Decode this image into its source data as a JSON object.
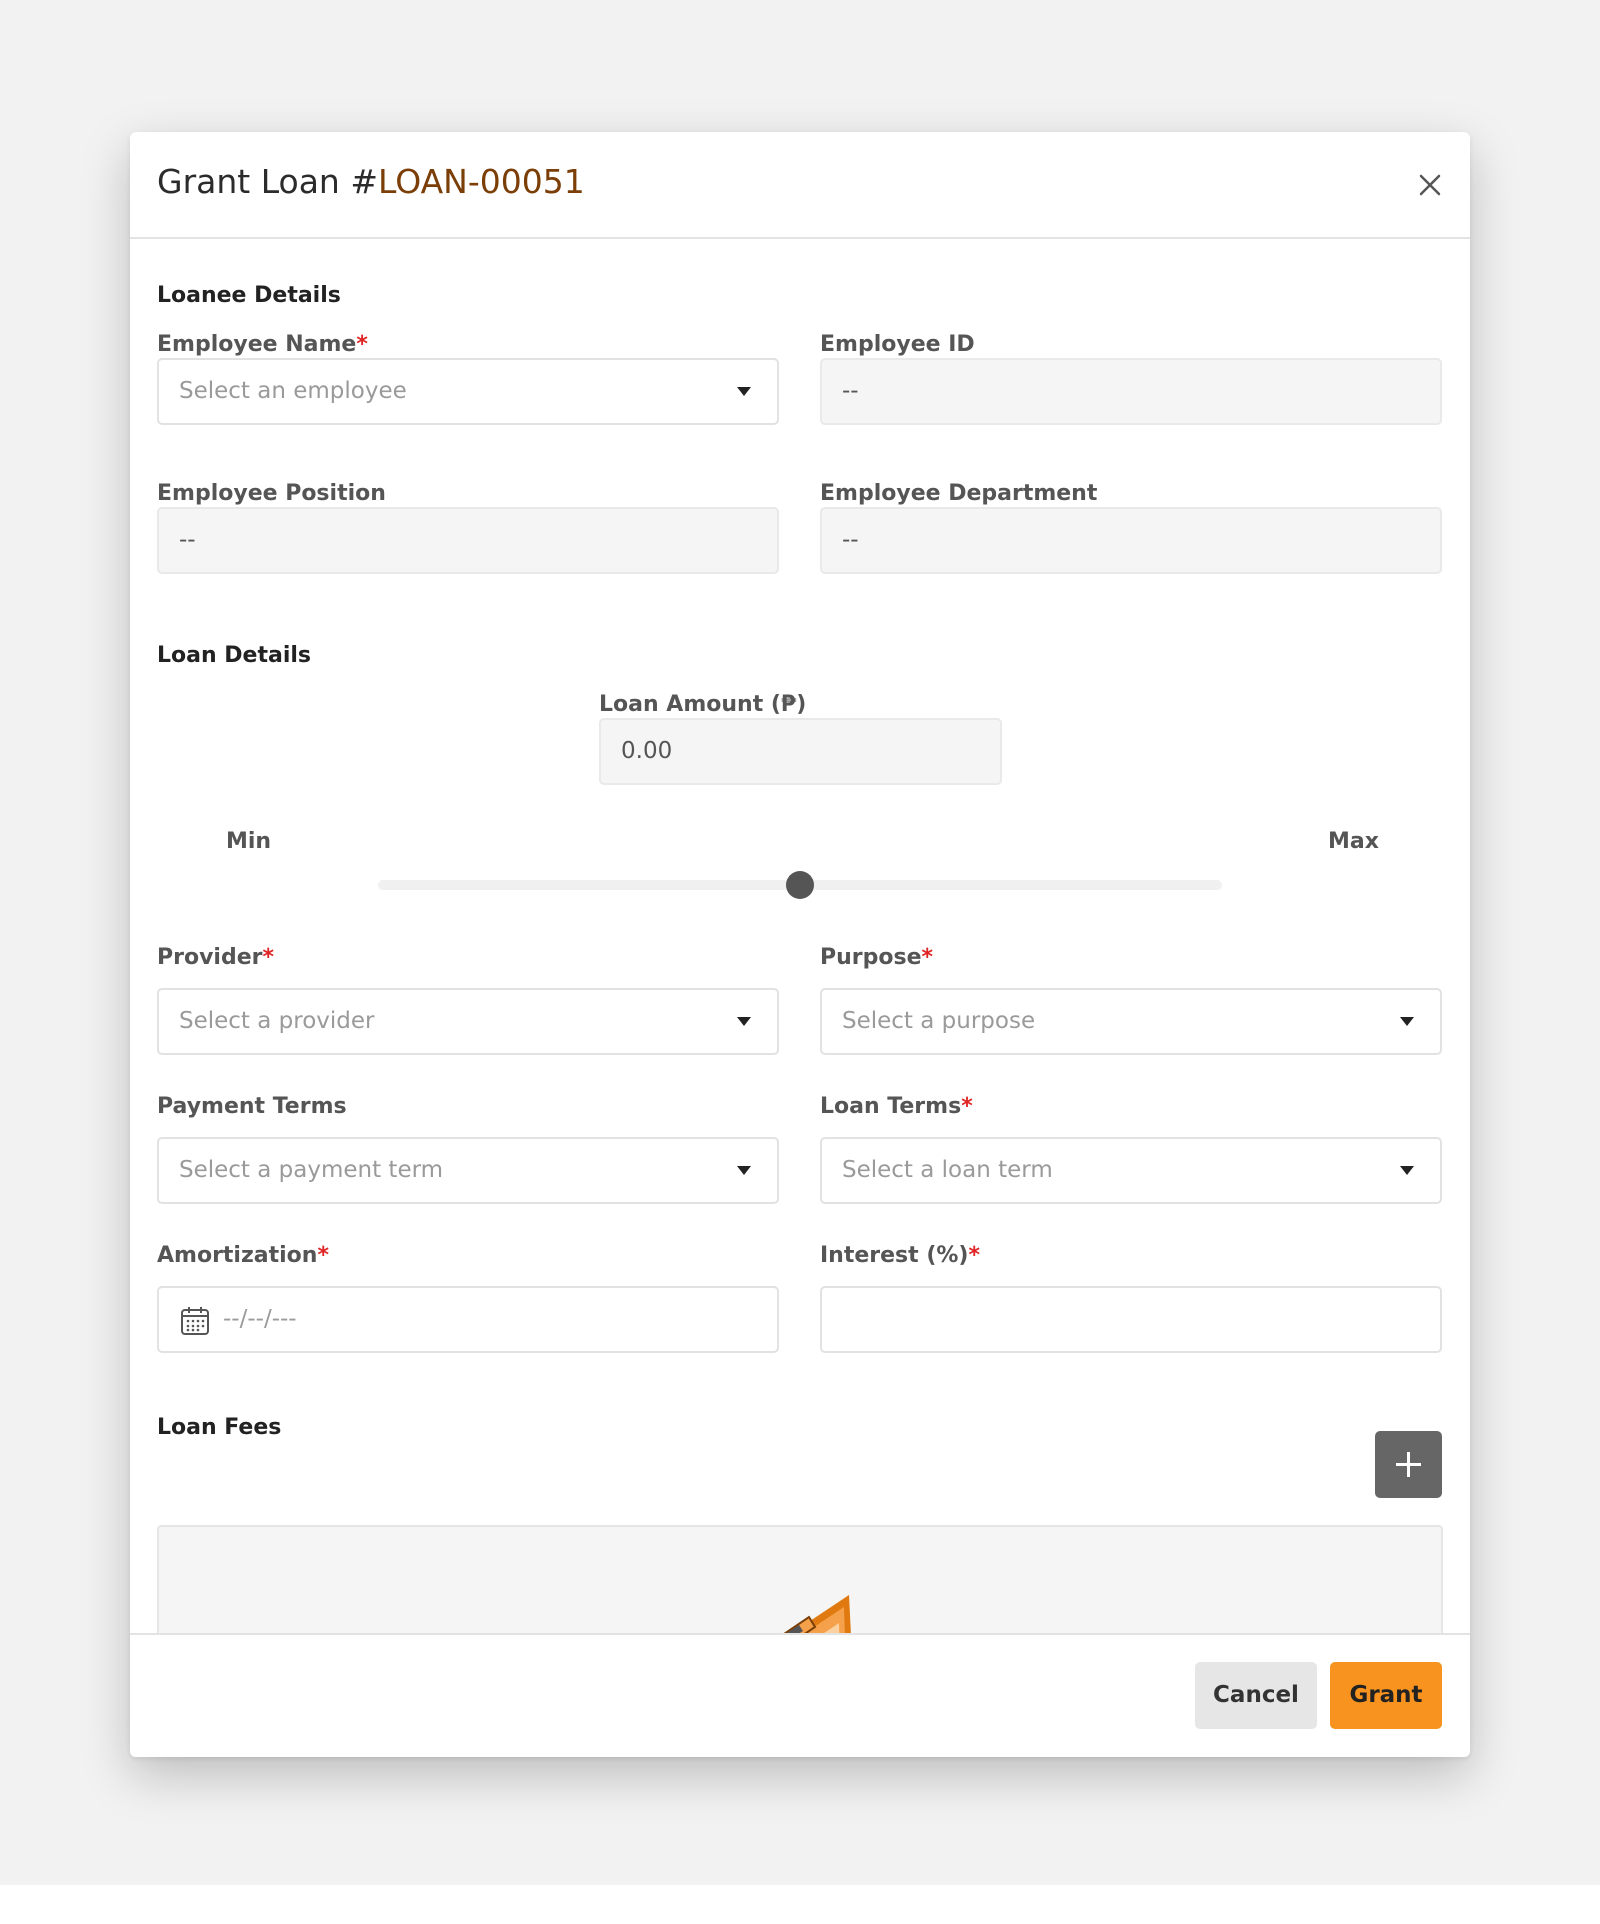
{
  "modal": {
    "title_prefix": "Grant Loan #",
    "loan_id": "LOAN-00051"
  },
  "loanee": {
    "section_title": "Loanee Details",
    "employee_name": {
      "label": "Employee Name",
      "placeholder": "Select an employee",
      "required": "*"
    },
    "employee_id": {
      "label": "Employee ID",
      "value": "--"
    },
    "employee_position": {
      "label": "Employee Position",
      "value": "--"
    },
    "employee_department": {
      "label": "Employee Department",
      "value": "--"
    }
  },
  "loan": {
    "section_title": "Loan Details",
    "amount": {
      "label": "Loan Amount (₱)",
      "value": "0.00"
    },
    "slider": {
      "min_label": "Min",
      "max_label": "Max",
      "position_fraction": 0.5
    },
    "provider": {
      "label": "Provider",
      "placeholder": "Select a provider",
      "required": "*"
    },
    "purpose": {
      "label": "Purpose",
      "placeholder": "Select a purpose",
      "required": "*"
    },
    "payment_terms": {
      "label": "Payment Terms",
      "placeholder": "Select a payment term"
    },
    "loan_terms": {
      "label": "Loan Terms",
      "placeholder": "Select a loan term",
      "required": "*"
    },
    "amortization": {
      "label": "Amortization",
      "placeholder": "--/--/---",
      "required": "*"
    },
    "interest": {
      "label": "Interest (%)",
      "value": "",
      "required": "*"
    }
  },
  "fees": {
    "section_title": "Loan Fees",
    "add_icon": "plus-icon",
    "empty_illustration": "clipboard-illustration"
  },
  "footer": {
    "cancel_label": "Cancel",
    "grant_label": "Grant"
  },
  "colors": {
    "accent": "#f7931e",
    "loan_id": "#7a3e06",
    "required": "#e02424",
    "add_button": "#666666",
    "slider_thumb": "#555555"
  }
}
